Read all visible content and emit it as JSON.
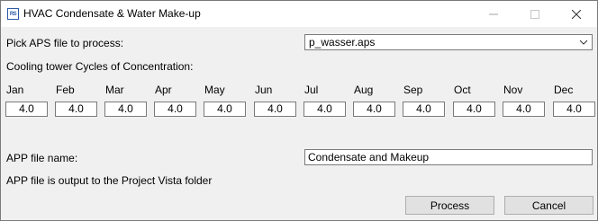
{
  "window": {
    "icon_text": "RS",
    "title": "HVAC Condensate & Water Make-up",
    "controls": {
      "minimize": "minimize-icon",
      "maximize": "maximize-icon",
      "close": "close-icon"
    }
  },
  "form": {
    "pick_label": "Pick APS file to process:",
    "aps_file": "p_wasser.aps",
    "cycles_label": "Cooling tower Cycles of Concentration:",
    "months": [
      {
        "label": "Jan",
        "value": "4.0"
      },
      {
        "label": "Feb",
        "value": "4.0"
      },
      {
        "label": "Mar",
        "value": "4.0"
      },
      {
        "label": "Apr",
        "value": "4.0"
      },
      {
        "label": "May",
        "value": "4.0"
      },
      {
        "label": "Jun",
        "value": "4.0"
      },
      {
        "label": "Jul",
        "value": "4.0"
      },
      {
        "label": "Aug",
        "value": "4.0"
      },
      {
        "label": "Sep",
        "value": "4.0"
      },
      {
        "label": "Oct",
        "value": "4.0"
      },
      {
        "label": "Nov",
        "value": "4.0"
      },
      {
        "label": "Dec",
        "value": "4.0"
      }
    ],
    "app_file_label": "APP file name:",
    "app_file_name": "Condensate and Makeup",
    "output_note": "APP file is output to the Project Vista folder"
  },
  "buttons": {
    "process": "Process",
    "cancel": "Cancel"
  }
}
